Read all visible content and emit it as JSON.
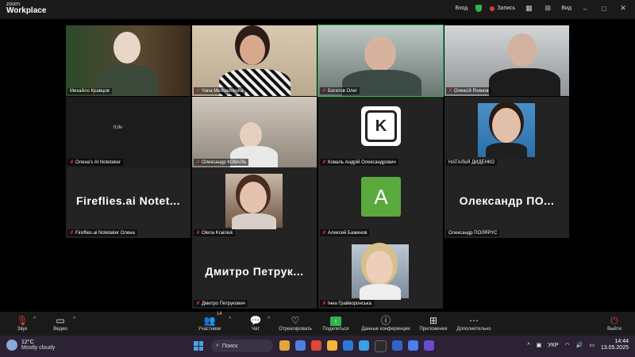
{
  "app": {
    "brand_line1": "zoom",
    "brand_line2": "Workplace"
  },
  "topbar": {
    "sign_in": "Вход",
    "record": "Запись",
    "view": "Вид",
    "window_buttons": [
      "–",
      "□",
      "✕"
    ]
  },
  "participants": [
    "Михайло Кравцов",
    "Yana Medvedovska",
    "Богатов Олег",
    "Олексій Роянов",
    "Олена's AI Notetaker",
    "Олександр КОВАЛЬ",
    "Коваль Андрій Олександрович",
    "НАТАЛЬЯ ДИДЕНКО",
    "Fireflies.ai Notetaker Олена",
    "Olena Krainiuk",
    "Алексей Бажинов",
    "Олександр ПОЛЯРУС",
    "Дмитро Петрукович",
    "Інна Грайворонська"
  ],
  "big_names": {
    "fireflies": "Fireflies.ai  Notet...",
    "polyarus": "Олександр  ПО...",
    "petrukovych": "Дмитро  Петрук..."
  },
  "avatar_letter": "A",
  "k_logo_letter": "K",
  "otter_text": "tl;dv",
  "toolbar": {
    "items": [
      {
        "label": "Звук",
        "icon": "mic-off-icon"
      },
      {
        "label": "Видео",
        "icon": "video-icon"
      },
      {
        "label": "Участники",
        "icon": "participants-icon"
      },
      {
        "label": "Чат",
        "icon": "chat-icon"
      },
      {
        "label": "Отреагировать",
        "icon": "heart-icon"
      },
      {
        "label": "Поделиться",
        "icon": "share-icon"
      },
      {
        "label": "Данные конференции",
        "icon": "info-icon"
      },
      {
        "label": "Приложения",
        "icon": "apps-icon"
      },
      {
        "label": "Дополнительно",
        "icon": "more-icon"
      },
      {
        "label": "Выйти",
        "icon": "leave-icon"
      }
    ],
    "participants_count": "14"
  },
  "taskbar": {
    "weather_temp": "12°C",
    "weather_desc": "Mostly cloudy",
    "search_placeholder": "Поиск",
    "language": "УКР",
    "time": "14:44",
    "date": "13.05.2025"
  },
  "colors": {
    "active_speaker": "#2fc05a",
    "muted": "#e23b3b",
    "share": "#2fb44a",
    "avatar_bg": "#5aa93c"
  }
}
